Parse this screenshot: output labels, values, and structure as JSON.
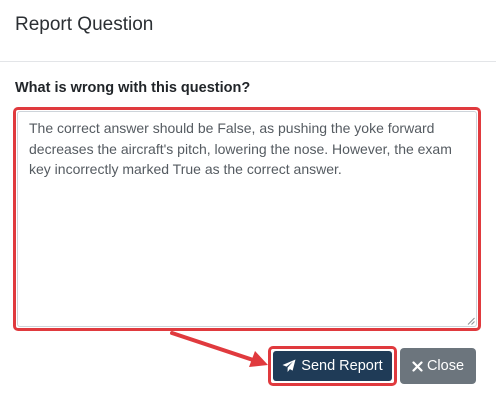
{
  "modal": {
    "title": "Report Question"
  },
  "form": {
    "label": "What is wrong with this question?",
    "report_text": "The correct answer should be False, as pushing the yoke forward decreases the aircraft's pitch, lowering the nose. However, the exam key incorrectly marked True as the correct answer."
  },
  "buttons": {
    "send_label": "Send Report",
    "send_icon": "paper-plane-icon",
    "close_label": "Close",
    "close_icon": "times-icon"
  },
  "colors": {
    "highlight": "#e03a3e",
    "send_button": "#1f3b57",
    "close_button": "#6c757d"
  }
}
